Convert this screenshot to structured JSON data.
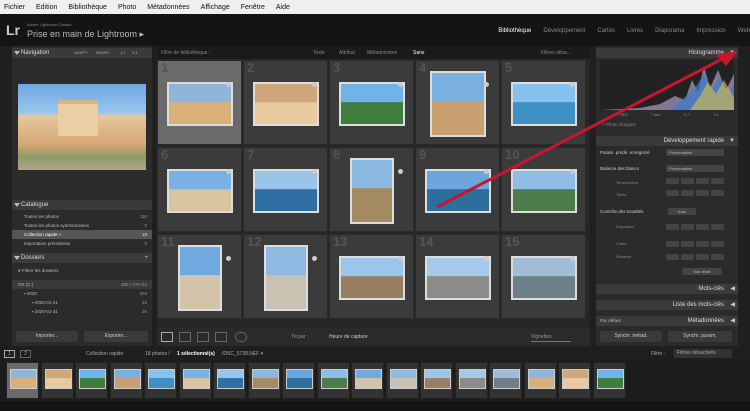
{
  "menu": [
    "Fichier",
    "Edition",
    "Bibliothèque",
    "Photo",
    "Métadonnées",
    "Affichage",
    "Fenêtre",
    "Aide"
  ],
  "idplate": {
    "logo": "Lr",
    "subtitle": "Adobe Lightroom Classic",
    "title": "Prise en main de Lightroom ▸"
  },
  "modules": {
    "items": [
      "Bibliothèque",
      "Développement",
      "Cartes",
      "Livres",
      "Diaporama",
      "Impression",
      "Web"
    ],
    "active": 0
  },
  "navigator": {
    "label": "Navigation",
    "zoom": [
      "ADAPT.",
      "REMPL.",
      "1:1",
      "4:1"
    ]
  },
  "catalog": {
    "label": "Catalogue",
    "items": [
      {
        "name": "Toutes les photos",
        "count": "110"
      },
      {
        "name": "Toutes les photos synchronisées",
        "count": "0"
      },
      {
        "name": "Collection rapide +",
        "count": "18"
      },
      {
        "name": "Importation précédente",
        "count": "0"
      }
    ]
  },
  "folders": {
    "label": "Dossiers",
    "filter": "Filtrer les dossiers",
    "volume": "OS (C:)",
    "volume_info": "380 / 476 Go",
    "items": [
      {
        "name": "2020",
        "count": "203"
      },
      {
        "name": "2020-01-21",
        "count": "33"
      },
      {
        "name": "2020-01-31",
        "count": "26"
      }
    ]
  },
  "left_buttons": {
    "import": "Importer...",
    "export": "Exporter..."
  },
  "filterbar": {
    "label": "Filtre de bibliothèque :",
    "options": [
      "Texte",
      "Attribut",
      "Métadonnées",
      "Sans"
    ],
    "active": 3,
    "preset": "Filtres désa..."
  },
  "grid_numbers": [
    "1",
    "2",
    "3",
    "4",
    "5",
    "6",
    "7",
    "8",
    "9",
    "10",
    "11",
    "12",
    "13",
    "14",
    "15"
  ],
  "toolbar": {
    "sort_label": "Tri par :",
    "sort_value": "Heure de capture",
    "thumbs": "Vignettes"
  },
  "right": {
    "histogram": "Histogramme",
    "histo_info": [
      "? ISO",
      "? mm",
      "f / ?",
      "? s"
    ],
    "original": "Photo d'origine",
    "quick_develop": "Développement rapide",
    "preset_label": "Param. prédé. enregistré",
    "preset_value": "Personnalisé",
    "wb_label": "Balance des blancs",
    "wb_value": "Personnalisé",
    "temp": "Température",
    "tint": "Teinte",
    "tone_label": "Contrôle des tonalités",
    "auto": "Auto",
    "exposure": "Exposition",
    "clarity": "Clarté",
    "vibrance": "Éclatnce",
    "reset": "Tout réinit.",
    "keywords": "Mots-clés",
    "keyword_list": "Liste des mots-clés",
    "metadata": "Métadonnées",
    "meta_preset": "Par défaut",
    "sync_meta": "Synchr. métad.",
    "sync_settings": "Synchr. param."
  },
  "filmstrip": {
    "pages": [
      "1",
      "2"
    ],
    "source": "Collection rapide",
    "count_text": "18 photos /",
    "selected": "1 sélectionné(s)",
    "file": "/DSC_6738.NEF ▾",
    "filter_label": "Filtre :",
    "filter_value": "Filtres désactivés"
  },
  "colors": {
    "accent": "#c8162e",
    "panel": "#2b2b2b",
    "selected_cell": "#6a6a6a"
  }
}
